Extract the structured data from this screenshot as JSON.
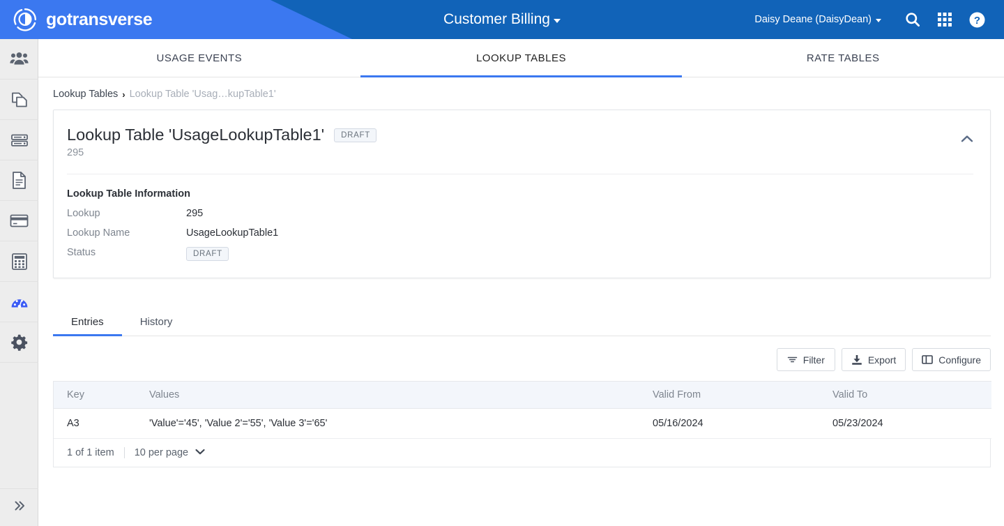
{
  "topbar": {
    "brand": "gotransverse",
    "brand_logo_icon": "circle-arrow-logo-icon",
    "app_title": "Customer Billing",
    "app_title_caret_icon": "caret-down-icon",
    "user": "Daisy Deane (DaisyDean)",
    "search_icon": "search-icon",
    "apps_icon": "grid-apps-icon",
    "help_icon": "help-circle-icon",
    "bg_color": "#1163B8",
    "accent_color": "#3B78F0"
  },
  "sidebar": {
    "items": [
      {
        "name": "customers",
        "icon": "users-group-icon",
        "active": false
      },
      {
        "name": "products",
        "icon": "copy-pages-icon",
        "active": false
      },
      {
        "name": "accounts",
        "icon": "server-stack-icon",
        "active": false
      },
      {
        "name": "invoices",
        "icon": "document-icon",
        "active": false
      },
      {
        "name": "payments",
        "icon": "credit-card-icon",
        "active": false
      },
      {
        "name": "billing",
        "icon": "calculator-icon",
        "active": false
      },
      {
        "name": "usage",
        "icon": "speedometer-icon",
        "active": true
      },
      {
        "name": "settings",
        "icon": "gear-icon",
        "active": false
      }
    ],
    "expand_icon": "double-chevron-right-icon"
  },
  "tabs_top": [
    {
      "label": "USAGE EVENTS",
      "active": false
    },
    {
      "label": "LOOKUP TABLES",
      "active": true
    },
    {
      "label": "RATE TABLES",
      "active": false
    }
  ],
  "breadcrumb": {
    "root": "Lookup Tables",
    "separator": "›",
    "current": "Lookup Table 'Usag…kupTable1'"
  },
  "card": {
    "title": "Lookup Table 'UsageLookupTable1'",
    "status_badge": "DRAFT",
    "subtitle": "295",
    "collapse_icon": "chevron-up-icon",
    "section_title": "Lookup Table Information",
    "fields": [
      {
        "label": "Lookup",
        "value": "295",
        "type": "text"
      },
      {
        "label": "Lookup Name",
        "value": "UsageLookupTable1",
        "type": "text"
      },
      {
        "label": "Status",
        "value": "DRAFT",
        "type": "badge"
      }
    ]
  },
  "tabs_sub": [
    {
      "label": "Entries",
      "active": true
    },
    {
      "label": "History",
      "active": false
    }
  ],
  "toolbar": {
    "filter_label": "Filter",
    "filter_icon": "filter-icon",
    "export_label": "Export",
    "export_icon": "download-export-icon",
    "configure_label": "Configure",
    "configure_icon": "columns-configure-icon"
  },
  "table": {
    "columns": [
      "Key",
      "Values",
      "Valid From",
      "Valid To"
    ],
    "rows": [
      {
        "key": "A3",
        "values": "'Value'='45', 'Value 2'='55', 'Value 3'='65'",
        "valid_from": "05/16/2024",
        "valid_to": "05/23/2024"
      }
    ]
  },
  "pager": {
    "count": "1 of 1 item",
    "per_page": "10 per page",
    "chevron_icon": "chevron-down-icon"
  }
}
